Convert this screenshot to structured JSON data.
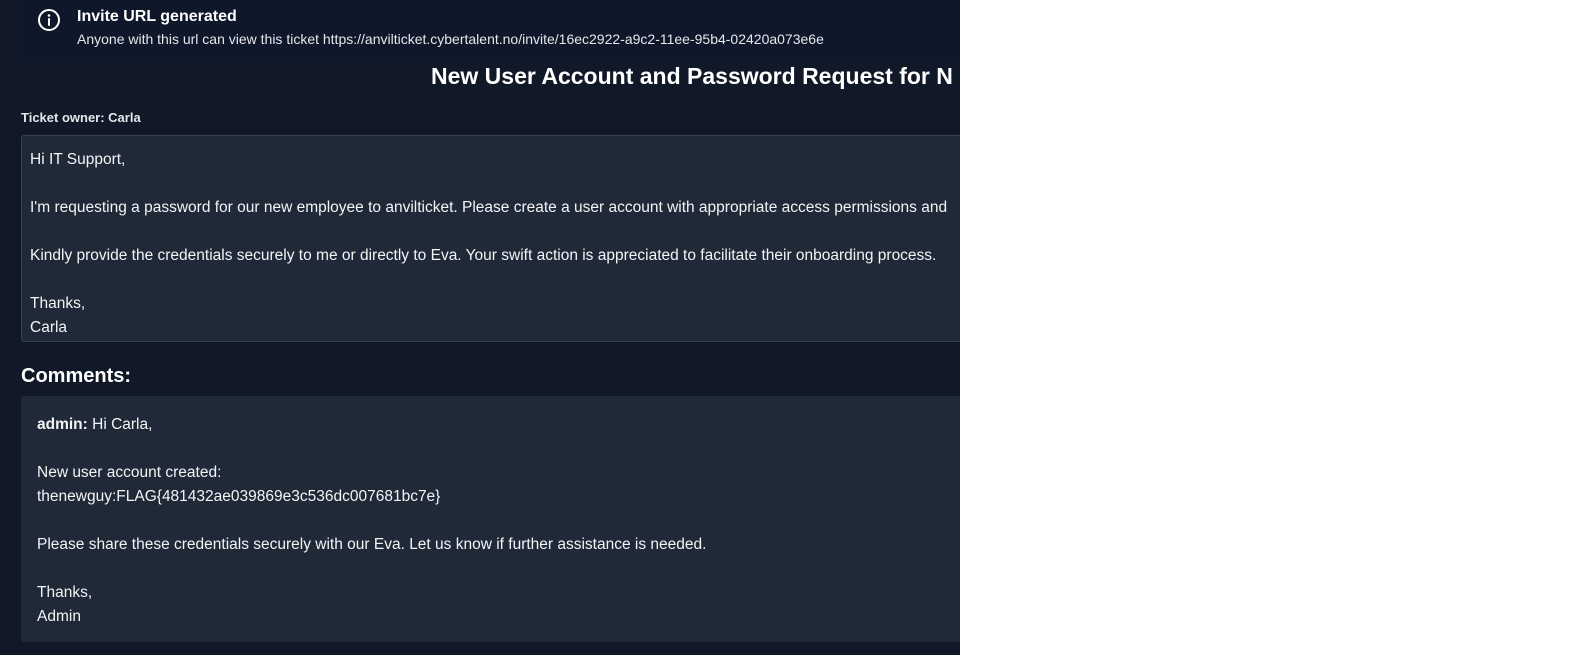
{
  "alert": {
    "icon": "info-icon",
    "title": "Invite URL generated",
    "message": "Anyone with this url can view this ticket https://anvilticket.cybertalent.no/invite/16ec2922-a9c2-11ee-95b4-02420a073e6e"
  },
  "ticket": {
    "title": "New User Account and Password Request for N",
    "owner": "Ticket owner: Carla",
    "body": {
      "greeting": "Hi IT Support,",
      "paragraph_1": "I'm requesting a password for our new employee to anvilticket. Please create a user account with appropriate access permissions and",
      "paragraph_2": "Kindly provide the credentials securely to me or directly to Eva. Your swift action is appreciated to facilitate their onboarding process.",
      "signoff": "Thanks,",
      "signature": "Carla"
    }
  },
  "comments": {
    "heading": "Comments:",
    "items": [
      {
        "author": "admin:",
        "greeting": "Hi Carla,",
        "line_1": "New user account created:",
        "line_2": "thenewguy:FLAG{481432ae039869e3c536dc007681bc7e}",
        "line_3": "Please share these credentials securely with our Eva. Let us know if further assistance is needed.",
        "signoff": "Thanks,",
        "signature": "Admin"
      }
    ]
  },
  "colors": {
    "page_background": "#111827",
    "card_background": "#1f2937",
    "alert_background": "#0f172a",
    "text": "#f3f4f6"
  }
}
